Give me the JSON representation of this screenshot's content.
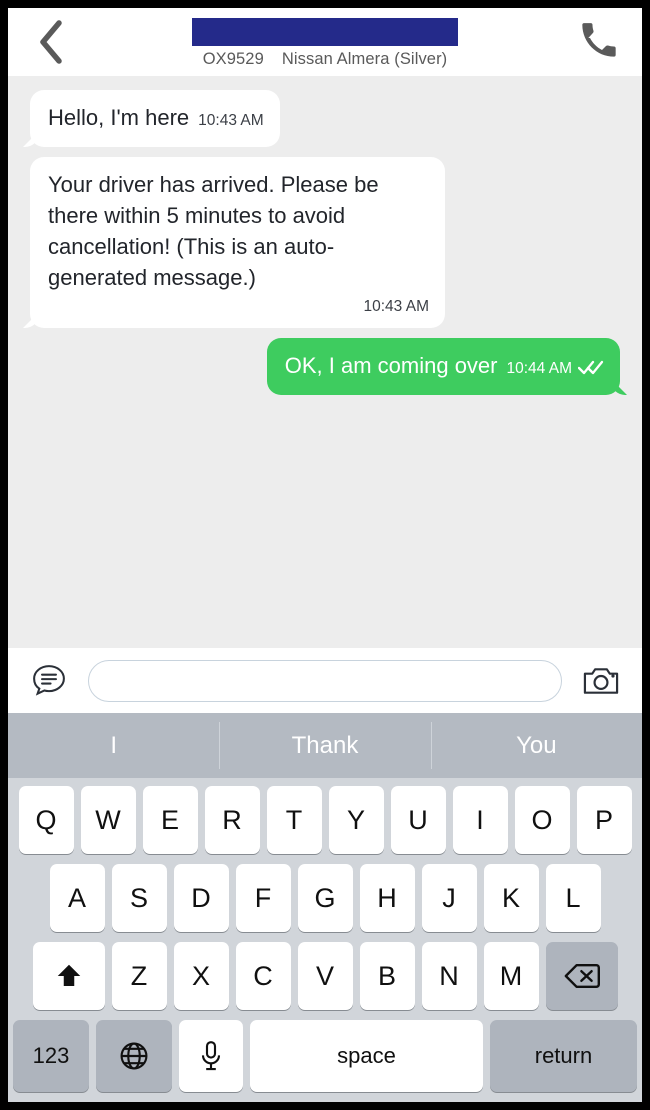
{
  "header": {
    "back_icon": "chevron-left-icon",
    "contact_name_redacted": "",
    "vehicle_plate": "OX9529",
    "vehicle_model": "Nissan Almera (Silver)",
    "call_icon": "phone-icon",
    "redaction_color": "#242a8a"
  },
  "chat": {
    "background_color": "#ededed",
    "messages": [
      {
        "direction": "in",
        "text": "Hello, I'm here",
        "time": "10:43 AM",
        "meta_layout": "inline",
        "status": ""
      },
      {
        "direction": "in",
        "text": "Your driver has arrived. Please be there within 5 minutes to avoid cancellation! (This is an auto-generated message.)",
        "time": "10:43 AM",
        "meta_layout": "block",
        "status": ""
      },
      {
        "direction": "out",
        "text": "OK, I am coming over",
        "time": "10:44 AM",
        "meta_layout": "inline",
        "status": "double-check-icon"
      }
    ],
    "outgoing_bubble_color": "#3ecc5f",
    "incoming_bubble_color": "#ffffff"
  },
  "input_bar": {
    "compose_icon": "speech-bubble-lines-icon",
    "message_value": "",
    "message_placeholder": "",
    "camera_icon": "camera-icon"
  },
  "predictive_bar": {
    "background_color": "#b4bac2",
    "suggestions": [
      "I",
      "Thank",
      "You"
    ]
  },
  "keyboard": {
    "background_color": "#d1d5da",
    "row1": [
      "Q",
      "W",
      "E",
      "R",
      "T",
      "Y",
      "U",
      "I",
      "O",
      "P"
    ],
    "row2": [
      "A",
      "S",
      "D",
      "F",
      "G",
      "H",
      "J",
      "K",
      "L"
    ],
    "row3_letters": [
      "Z",
      "X",
      "C",
      "V",
      "B",
      "N",
      "M"
    ],
    "shift_icon": "shift-arrow-icon",
    "backspace_icon": "backspace-delete-icon",
    "numbers_label": "123",
    "globe_icon": "globe-icon",
    "mic_icon": "microphone-icon",
    "space_label": "space",
    "return_label": "return"
  }
}
